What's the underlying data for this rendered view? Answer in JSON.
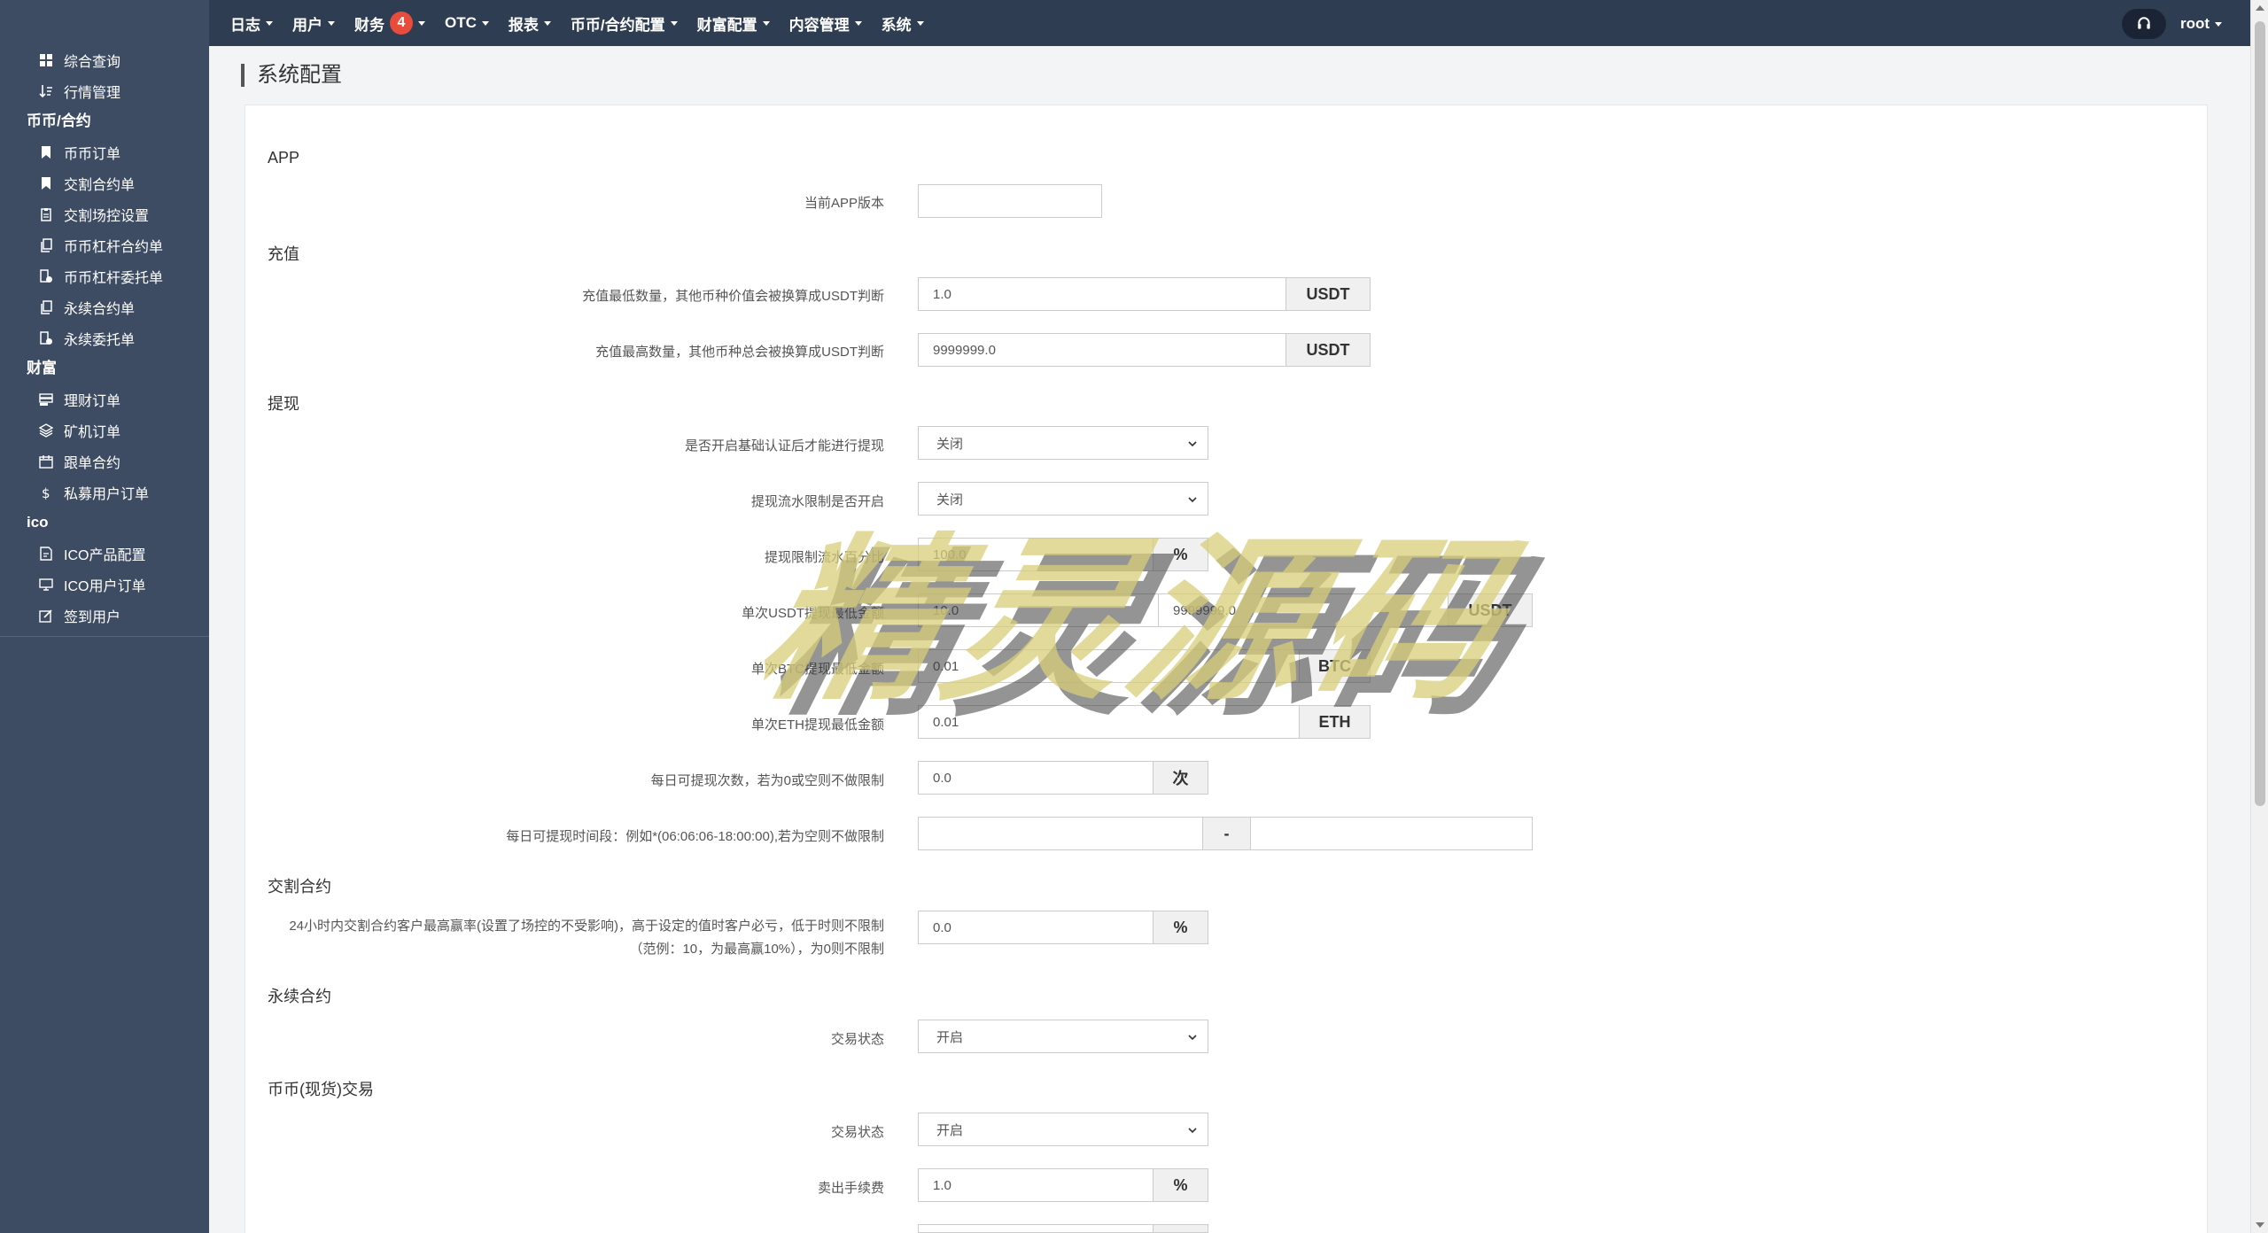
{
  "sidebar": {
    "top_items": [
      {
        "label": "综合查询",
        "icon": "dashboard-icon"
      },
      {
        "label": "行情管理",
        "icon": "sort-icon"
      }
    ],
    "groups": [
      {
        "title": "币币/合约",
        "items": [
          {
            "label": "币币订单",
            "icon": "bookmark-icon"
          },
          {
            "label": "交割合约单",
            "icon": "bookmark-icon"
          },
          {
            "label": "交割场控设置",
            "icon": "clipboard-icon"
          },
          {
            "label": "币币杠杆合约单",
            "icon": "copy-icon"
          },
          {
            "label": "币币杠杆委托单",
            "icon": "doc-clock-icon"
          },
          {
            "label": "永续合约单",
            "icon": "copy-icon"
          },
          {
            "label": "永续委托单",
            "icon": "doc-clock-icon"
          }
        ]
      },
      {
        "title": "财富",
        "items": [
          {
            "label": "理财订单",
            "icon": "database-icon"
          },
          {
            "label": "矿机订单",
            "icon": "layers-icon"
          },
          {
            "label": "跟单合约",
            "icon": "calendar-icon"
          },
          {
            "label": "私募用户订单",
            "icon": "dollar-icon"
          }
        ]
      },
      {
        "title": "ico",
        "items": [
          {
            "label": "ICO产品配置",
            "icon": "edit-doc-icon"
          },
          {
            "label": "ICO用户订单",
            "icon": "monitor-icon"
          },
          {
            "label": "签到用户",
            "icon": "edit-icon"
          }
        ]
      }
    ]
  },
  "topnav": {
    "items": [
      "日志",
      "用户",
      "财务",
      "OTC",
      "报表",
      "币币/合约配置",
      "财富配置",
      "内容管理",
      "系统"
    ],
    "finance_badge": "4",
    "username": "root"
  },
  "page": {
    "title": "系统配置"
  },
  "sections": {
    "app": "APP",
    "recharge": "充值",
    "withdraw": "提现",
    "delivery": "交割合约",
    "perpetual": "永续合约",
    "spot": "币币(现货)交易"
  },
  "fields": {
    "app_version": {
      "label": "当前APP版本",
      "value": ""
    },
    "recharge_min": {
      "label": "充值最低数量，其他币种价值会被换算成USDT判断",
      "value": "1.0",
      "unit": "USDT"
    },
    "recharge_max": {
      "label": "充值最高数量，其他币种总会被换算成USDT判断",
      "value": "9999999.0",
      "unit": "USDT"
    },
    "withdraw_auth": {
      "label": "是否开启基础认证后才能进行提现",
      "value": "关闭"
    },
    "withdraw_flow": {
      "label": "提现流水限制是否开启",
      "value": "关闭"
    },
    "withdraw_limit": {
      "label": "提现限制流水百分比",
      "value": "100.0",
      "unit": "%"
    },
    "withdraw_usdt": {
      "label": "单次USDT提现最低金额",
      "min": "10.0",
      "max": "9999999.0",
      "unit": "USDT"
    },
    "withdraw_btc": {
      "label": "单次BTC提现最低金额",
      "value": "0.01",
      "unit": "BTC"
    },
    "withdraw_eth": {
      "label": "单次ETH提现最低金额",
      "value": "0.01",
      "unit": "ETH"
    },
    "withdraw_times": {
      "label": "每日可提现次数，若为0或空则不做限制",
      "value": "0.0",
      "unit": "次"
    },
    "withdraw_period": {
      "label": "每日可提现时间段：例如*(06:06:06-18:00:00),若为空则不做限制",
      "start": "",
      "sep": "-",
      "end": ""
    },
    "delivery_rate": {
      "label": "24小时内交割合约客户最高赢率(设置了场控的不受影响)，高于设定的值时客户必亏，低于时则不限制（范例：10，为最高赢10%），为0则不限制",
      "value": "0.0",
      "unit": "%"
    },
    "perpetual_status": {
      "label": "交易状态",
      "value": "开启"
    },
    "spot_status": {
      "label": "交易状态",
      "value": "开启"
    },
    "spot_sell_fee": {
      "label": "卖出手续费",
      "value": "1.0",
      "unit": "%"
    }
  },
  "watermark": "精灵源码",
  "colors": {
    "sidebar": "#3d4b63",
    "topnav": "#2f3d53",
    "badge": "#e74c3c"
  }
}
